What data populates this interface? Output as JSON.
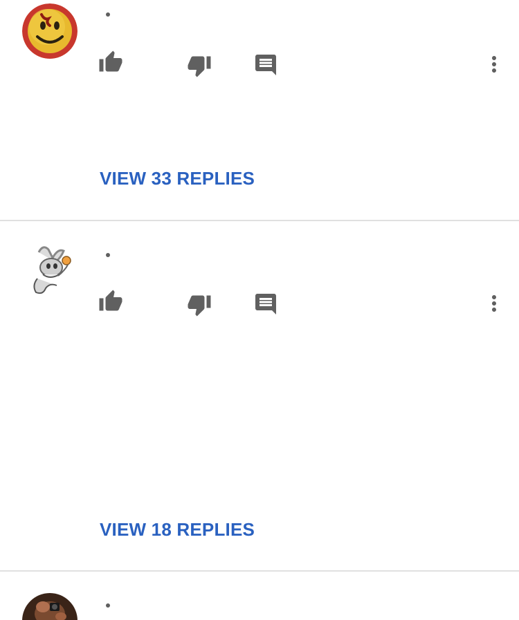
{
  "comments": [
    {
      "avatar_icon": "smiley-face-avatar-icon",
      "actions": {
        "like_icon": "thumb-up-icon",
        "dislike_icon": "thumb-down-icon",
        "reply_icon": "comment-icon",
        "more_icon": "more-vertical-icon"
      },
      "view_replies_label": "VIEW 33 REPLIES"
    },
    {
      "avatar_icon": "cartoon-rabbit-avatar-icon",
      "actions": {
        "like_icon": "thumb-up-icon",
        "dislike_icon": "thumb-down-icon",
        "reply_icon": "comment-icon",
        "more_icon": "more-vertical-icon"
      },
      "view_replies_label": "VIEW 18 REPLIES"
    },
    {
      "avatar_icon": "photo-avatar-icon"
    }
  ],
  "colors": {
    "link": "#2a61c0",
    "icon": "#606060",
    "divider": "#e0e0e0"
  }
}
